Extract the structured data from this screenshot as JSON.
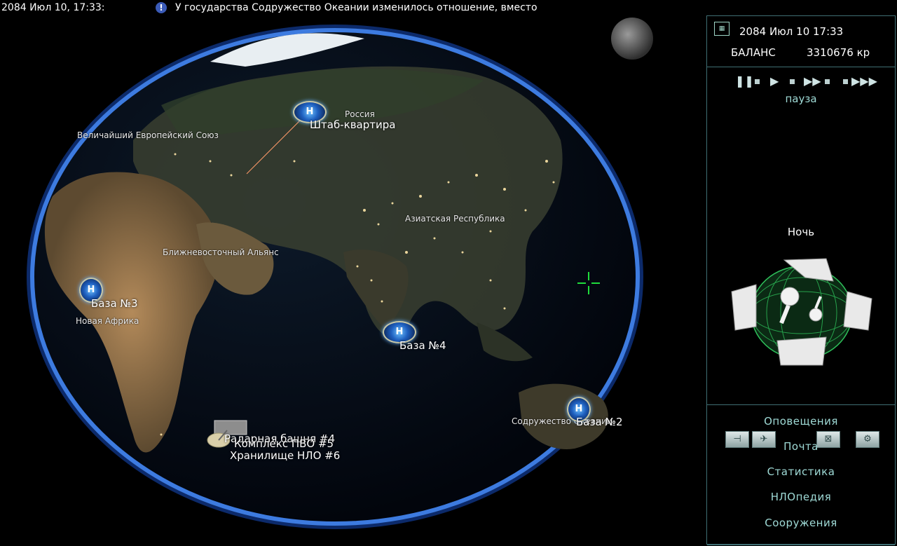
{
  "ticker": {
    "date": "2084 Июл 10, 17:33:",
    "alert_icon": "alert-icon",
    "message": "У государства Содружество Океании изменилось отношение, вместо"
  },
  "globe": {
    "regions": {
      "russia": "Россия",
      "europe": "Величайший Европейский Союз",
      "asia": "Азиатская Республика",
      "mideast": "Ближневосточный Альянс",
      "africa": "Новая Африка",
      "oceania": "Содружество Океании"
    },
    "bases": {
      "hq": "Штаб-квартира",
      "base3": "База №3",
      "base4": "База №4",
      "base2": "База №2",
      "radar": "Радарная башня #4",
      "pvo": "Комплекс ПВО #5",
      "storage": "Хранилище НЛО #6"
    }
  },
  "panel": {
    "date": "2084 Июл 10 17:33",
    "balance_label": "БАЛАНС",
    "balance_value": "3310676 кр",
    "time_state": "пауза",
    "daynight": "Ночь",
    "menu": {
      "alerts": "Оповещения",
      "mail": "Почта",
      "stats": "Статистика",
      "ufopedia": "НЛОпедия",
      "buildings": "Сооружения"
    }
  },
  "colors": {
    "panel_border": "#3f6f74",
    "panel_text": "#9fdad6",
    "crosshair": "#1fdc3c"
  }
}
